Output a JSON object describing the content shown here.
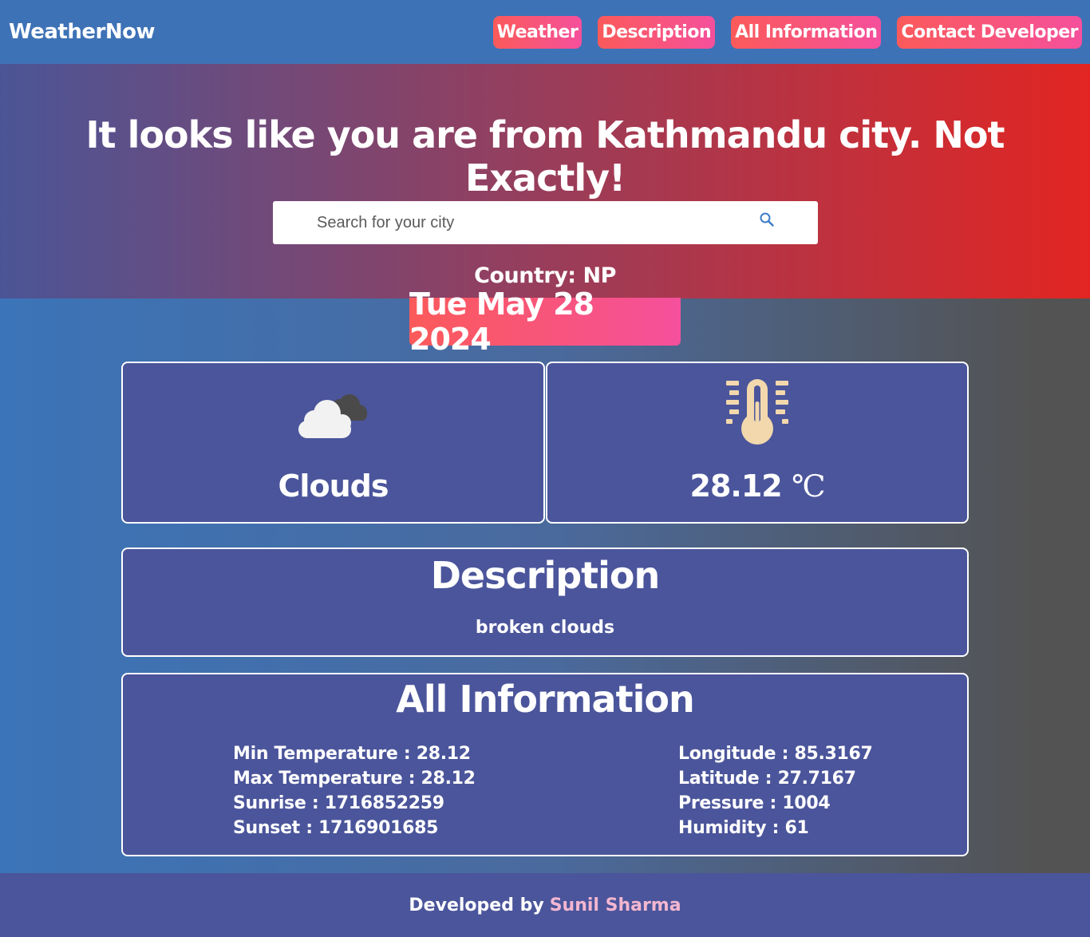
{
  "navbar": {
    "brand": "WeatherNow",
    "links": [
      {
        "label": "Weather"
      },
      {
        "label": "Description"
      },
      {
        "label": "All Information"
      },
      {
        "label": "Contact Developer"
      }
    ]
  },
  "hero": {
    "title": "It looks like you are from Kathmandu city. Not Exactly!",
    "search_placeholder": "Search for your city",
    "search_icon": "search-icon",
    "country": "Country: NP"
  },
  "date": "Tue May 28 2024",
  "weather": {
    "condition": "Clouds",
    "condition_icon": "cloud-icon",
    "temperature": "28.12",
    "temperature_unit": "℃",
    "temperature_icon": "thermometer-icon"
  },
  "description": {
    "title": "Description",
    "text": "broken clouds"
  },
  "all_information": {
    "title": "All Information",
    "left": [
      "Min Temperature : 28.12",
      "Max Temperature : 28.12",
      "Sunrise : 1716852259",
      "Sunset : 1716901685"
    ],
    "right": [
      "Longitude : 85.3167",
      "Latitude : 27.7167",
      "Pressure : 1004",
      "Humidity : 61"
    ]
  },
  "footer": {
    "developed_by": "Developed by",
    "developer_name": "Sunil Sharma"
  },
  "colors": {
    "accent_gradient_start": "#fb5a5a",
    "accent_gradient_end": "#f5509c",
    "card_bg": "#4b559b",
    "navbar_bg": "#3e72b6",
    "developer_name": "#f3b6d0"
  }
}
